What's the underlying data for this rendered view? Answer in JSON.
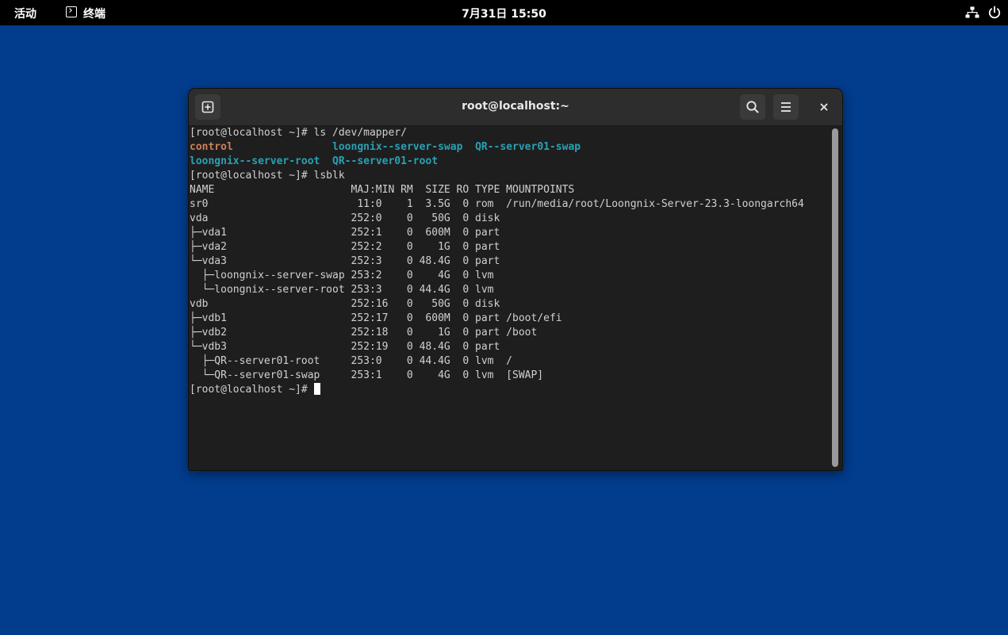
{
  "topbar": {
    "activities": "活动",
    "app_name": "终端",
    "clock": "7月31日 15:50",
    "icons": [
      "terminal-icon",
      "network-icon",
      "power-icon"
    ]
  },
  "window": {
    "title": "root@localhost:~",
    "buttons": [
      "new-tab-icon",
      "search-icon",
      "hamburger-menu-icon",
      "close-icon"
    ]
  },
  "terminal": {
    "colors": {
      "background": "#1e1e1e",
      "text": "#d0d0d0",
      "orange": "#c9825a",
      "cyan": "#2aa1b3"
    },
    "lines": [
      "[root@localhost ~]# ls /dev/mapper/",
      {
        "segments": [
          {
            "text": "control",
            "color": "orange"
          },
          {
            "text": "                ",
            "color": ""
          },
          {
            "text": "loongnix--server-swap",
            "color": "cyan"
          },
          {
            "text": "  ",
            "color": ""
          },
          {
            "text": "QR--server01-swap",
            "color": "cyan"
          }
        ]
      },
      {
        "segments": [
          {
            "text": "loongnix--server-root",
            "color": "cyan"
          },
          {
            "text": "  ",
            "color": ""
          },
          {
            "text": "QR--server01-root",
            "color": "cyan"
          }
        ]
      },
      "[root@localhost ~]# lsblk",
      "NAME                      MAJ:MIN RM  SIZE RO TYPE MOUNTPOINTS",
      "sr0                        11:0    1  3.5G  0 rom  /run/media/root/Loongnix-Server-23.3-loongarch64",
      "vda                       252:0    0   50G  0 disk",
      "├─vda1                    252:1    0  600M  0 part",
      "├─vda2                    252:2    0    1G  0 part",
      "└─vda3                    252:3    0 48.4G  0 part",
      "  ├─loongnix--server-swap 253:2    0    4G  0 lvm",
      "  └─loongnix--server-root 253:3    0 44.4G  0 lvm",
      "vdb                       252:16   0   50G  0 disk",
      "├─vdb1                    252:17   0  600M  0 part /boot/efi",
      "├─vdb2                    252:18   0    1G  0 part /boot",
      "└─vdb3                    252:19   0 48.4G  0 part",
      "  ├─QR--server01-root     253:0    0 44.4G  0 lvm  /",
      "  └─QR--server01-swap     253:1    0    4G  0 lvm  [SWAP]"
    ],
    "prompt": "[root@localhost ~]#"
  }
}
